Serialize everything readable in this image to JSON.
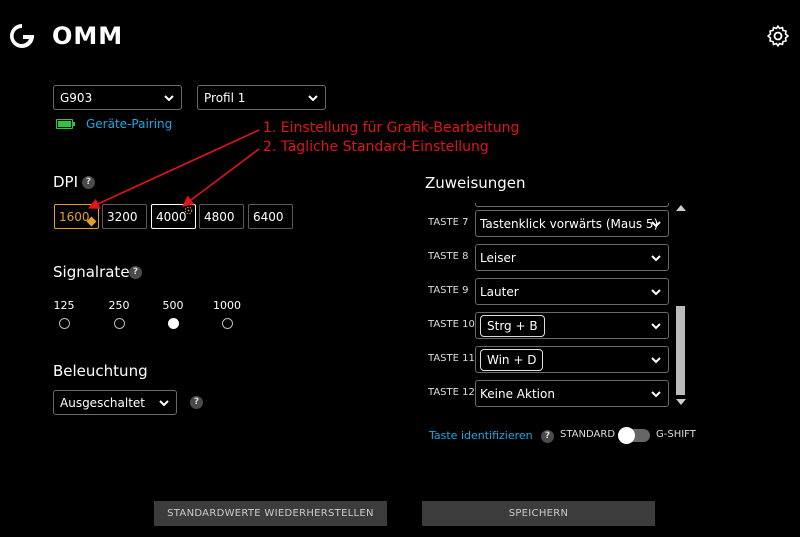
{
  "app": {
    "title": "OMM"
  },
  "device_select": {
    "value": "G903"
  },
  "profile_select": {
    "value": "Profil 1"
  },
  "pairing": {
    "label": "Geräte-Pairing"
  },
  "dpi": {
    "title": "DPI",
    "help": "?",
    "values": [
      "1600",
      "3200",
      "4000",
      "4800",
      "6400"
    ]
  },
  "rate": {
    "title": "Signalrate",
    "help": "?",
    "options": [
      "125",
      "250",
      "500",
      "1000"
    ],
    "selected": "500"
  },
  "lighting": {
    "title": "Beleuchtung",
    "value": "Ausgeschaltet",
    "help": "?"
  },
  "annotations": {
    "line1": "1. Einstellung für Grafik-Bearbeitung",
    "line2": "2. Tägliche Standard-Einstellung"
  },
  "assignments": {
    "title": "Zuweisungen",
    "rows": [
      {
        "key": "TASTE 7",
        "value": "Tastenklick vorwärts (Maus 5)"
      },
      {
        "key": "TASTE 8",
        "value": "Leiser"
      },
      {
        "key": "TASTE 9",
        "value": "Lauter"
      },
      {
        "key": "TASTE 10",
        "value": "Strg + B"
      },
      {
        "key": "TASTE 11",
        "value": "Win + D"
      },
      {
        "key": "TASTE 12",
        "value": "Keine Aktion"
      }
    ]
  },
  "identify": {
    "label": "Taste identifizieren",
    "help": "?"
  },
  "mode": {
    "standard": "STANDARD",
    "gshift": "G-SHIFT"
  },
  "buttons": {
    "reset": "STANDARDWERTE WIEDERHERSTELLEN",
    "save": "SPEICHERN"
  },
  "colors": {
    "accent": "#1ea7e3",
    "active_dpi": "#e0a02a",
    "battery": "#2ec63d",
    "annotation": "#e0141a"
  }
}
